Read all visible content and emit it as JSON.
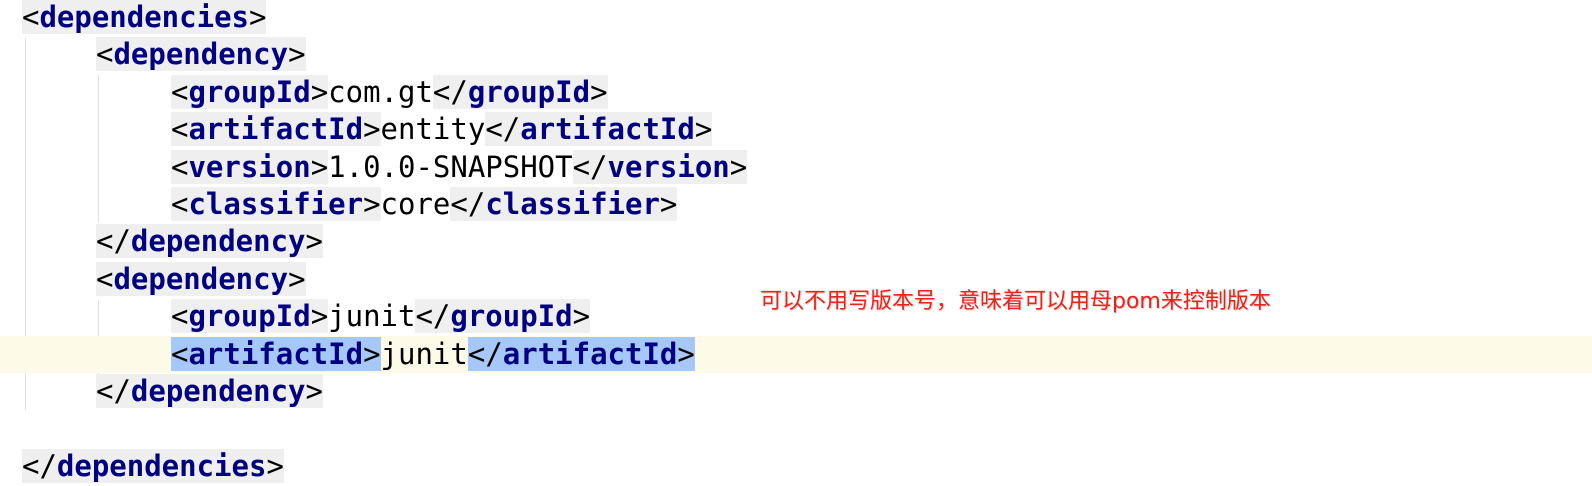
{
  "editor": {
    "lines": [
      {
        "segments": [
          {
            "t": "<",
            "c": "br"
          },
          {
            "t": "dependencies",
            "c": "tag"
          },
          {
            "t": ">",
            "c": "br"
          }
        ]
      },
      {
        "segments": [
          {
            "t": "<",
            "c": "br"
          },
          {
            "t": "dependency",
            "c": "tag"
          },
          {
            "t": ">",
            "c": "br"
          }
        ]
      },
      {
        "segments": [
          {
            "t": "<",
            "c": "br"
          },
          {
            "t": "groupId",
            "c": "tag"
          },
          {
            "t": ">",
            "c": "br"
          },
          {
            "t": "com.gt",
            "c": "text"
          },
          {
            "t": "</",
            "c": "br"
          },
          {
            "t": "groupId",
            "c": "tag"
          },
          {
            "t": ">",
            "c": "br"
          }
        ]
      },
      {
        "segments": [
          {
            "t": "<",
            "c": "br"
          },
          {
            "t": "artifactId",
            "c": "tag"
          },
          {
            "t": ">",
            "c": "br"
          },
          {
            "t": "entity",
            "c": "text"
          },
          {
            "t": "</",
            "c": "br"
          },
          {
            "t": "artifactId",
            "c": "tag"
          },
          {
            "t": ">",
            "c": "br"
          }
        ]
      },
      {
        "segments": [
          {
            "t": "<",
            "c": "br"
          },
          {
            "t": "version",
            "c": "tag"
          },
          {
            "t": ">",
            "c": "br"
          },
          {
            "t": "1.0.0-SNAPSHOT",
            "c": "text"
          },
          {
            "t": "</",
            "c": "br"
          },
          {
            "t": "version",
            "c": "tag"
          },
          {
            "t": ">",
            "c": "br"
          }
        ]
      },
      {
        "segments": [
          {
            "t": "<",
            "c": "br"
          },
          {
            "t": "classifier",
            "c": "tag"
          },
          {
            "t": ">",
            "c": "br"
          },
          {
            "t": "core",
            "c": "text"
          },
          {
            "t": "</",
            "c": "br"
          },
          {
            "t": "classifier",
            "c": "tag"
          },
          {
            "t": ">",
            "c": "br"
          }
        ]
      },
      {
        "segments": [
          {
            "t": "</",
            "c": "br"
          },
          {
            "t": "dependency",
            "c": "tag"
          },
          {
            "t": ">",
            "c": "br"
          }
        ]
      },
      {
        "segments": [
          {
            "t": "<",
            "c": "br"
          },
          {
            "t": "dependency",
            "c": "tag"
          },
          {
            "t": ">",
            "c": "br"
          }
        ]
      },
      {
        "segments": [
          {
            "t": "<",
            "c": "br"
          },
          {
            "t": "groupId",
            "c": "tag"
          },
          {
            "t": ">",
            "c": "br"
          },
          {
            "t": "junit",
            "c": "text"
          },
          {
            "t": "</",
            "c": "br"
          },
          {
            "t": "groupId",
            "c": "tag"
          },
          {
            "t": ">",
            "c": "br"
          }
        ]
      },
      {
        "current": true,
        "segments": [
          {
            "t": "<",
            "c": "br",
            "sel": true
          },
          {
            "t": "artifactId",
            "c": "tag",
            "sel": true
          },
          {
            "t": ">",
            "c": "br",
            "sel": true
          },
          {
            "t": "junit",
            "c": "text"
          },
          {
            "t": "</",
            "c": "br",
            "sel": true
          },
          {
            "t": "artifactId",
            "c": "tag",
            "sel": true
          },
          {
            "t": ">",
            "c": "br",
            "sel": true
          }
        ]
      },
      {
        "segments": [
          {
            "t": "</",
            "c": "br"
          },
          {
            "t": "dependency",
            "c": "tag"
          },
          {
            "t": ">",
            "c": "br"
          }
        ]
      },
      {
        "segments": []
      },
      {
        "segments": [
          {
            "t": "</",
            "c": "br"
          },
          {
            "t": "dependencies",
            "c": "tag"
          },
          {
            "t": ">",
            "c": "br"
          }
        ]
      }
    ]
  },
  "annotation": {
    "text": "可以不用写版本号，意味着可以用母pom来控制版本",
    "color": "#e8231c"
  },
  "colors": {
    "tag": "#000080",
    "tag_background": "#efefef",
    "selection": "#a6c8f8",
    "current_line": "#fdfbe8"
  }
}
